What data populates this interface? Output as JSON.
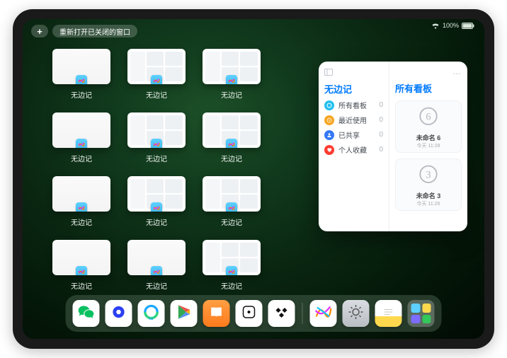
{
  "statusbar": {
    "wifi": "wifi",
    "battery": "100%"
  },
  "topbar": {
    "add": "+",
    "reopen": "重新打开已关闭的窗口"
  },
  "app_label": "无边记",
  "thumbs": [
    {
      "variant": "blank"
    },
    {
      "variant": "grid"
    },
    {
      "variant": "grid"
    },
    null,
    {
      "variant": "blank"
    },
    {
      "variant": "grid"
    },
    {
      "variant": "grid"
    },
    null,
    {
      "variant": "blank"
    },
    {
      "variant": "grid"
    },
    {
      "variant": "grid"
    },
    null,
    {
      "variant": "blank"
    },
    {
      "variant": "blank"
    },
    {
      "variant": "grid"
    },
    null
  ],
  "panel": {
    "title": "无边记",
    "items": [
      {
        "label": "所有看板",
        "count": "0",
        "color": "#22c0ef"
      },
      {
        "label": "最近使用",
        "count": "0",
        "color": "#f5a623"
      },
      {
        "label": "已共享",
        "count": "0",
        "color": "#3478f6"
      },
      {
        "label": "个人收藏",
        "count": "0",
        "color": "#ff3b30"
      }
    ],
    "right_title": "所有看板",
    "boards": [
      {
        "name": "未命名 6",
        "sub": "今天 11:28",
        "digit": "6"
      },
      {
        "name": "未命名 3",
        "sub": "今天 11:26",
        "digit": "3"
      }
    ]
  },
  "dock": [
    {
      "name": "wechat",
      "bg": "#ffffff"
    },
    {
      "name": "quark",
      "bg": "#ffffff"
    },
    {
      "name": "qqbrowser",
      "bg": "#ffffff"
    },
    {
      "name": "play",
      "bg": "#ffffff"
    },
    {
      "name": "books",
      "bg": "linear-gradient(#ff9f43,#ff7b1c)"
    },
    {
      "name": "dice",
      "bg": "#ffffff"
    },
    {
      "name": "tidal",
      "bg": "#ffffff"
    },
    {
      "name": "freeform",
      "bg": "#ffffff"
    },
    {
      "name": "settings",
      "bg": "linear-gradient(#d9dde1,#b9bec4)"
    },
    {
      "name": "notes",
      "bg": "linear-gradient(#fff 60%,#ffd84d 60%)"
    }
  ]
}
